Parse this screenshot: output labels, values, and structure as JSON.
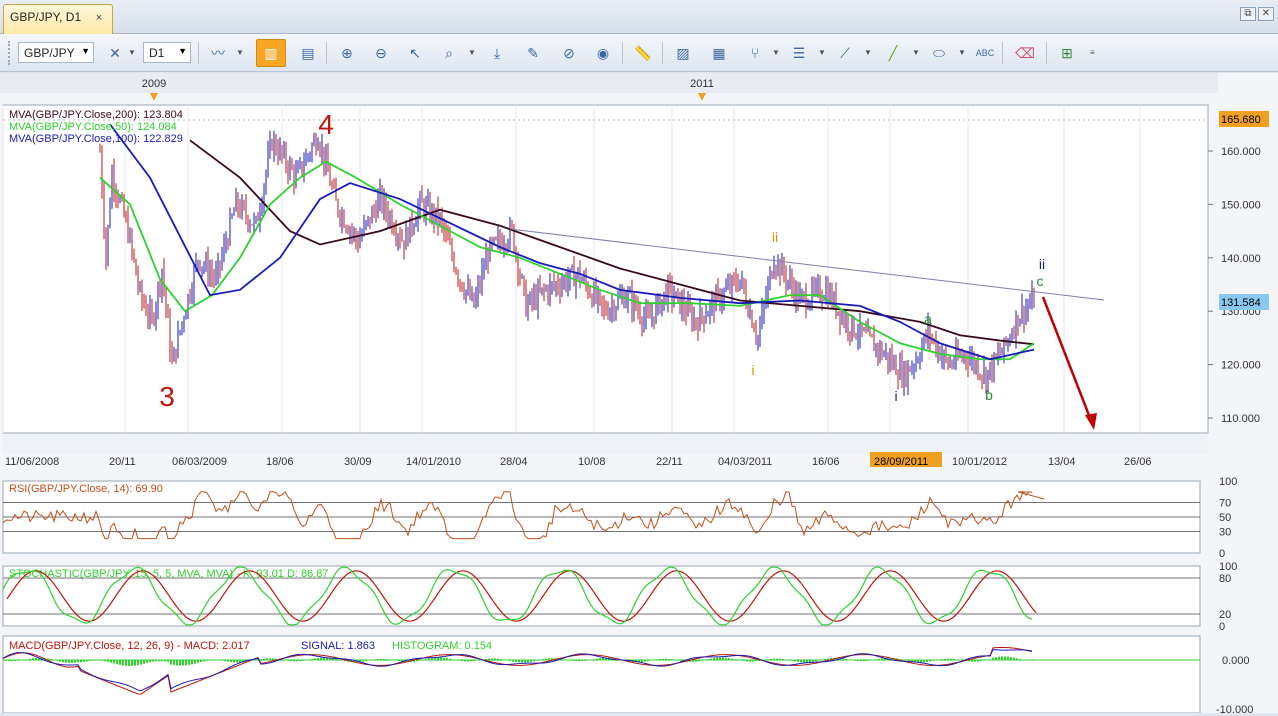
{
  "tab": {
    "title": "GBP/JPY, D1",
    "close": "×"
  },
  "window_buttons": [
    "⧉",
    "✕"
  ],
  "toolbar": {
    "symbol": "GBP/JPY",
    "timeframe": "D1",
    "tools": [
      "bar-chart-icon",
      "remove-indicator-icon",
      "line-chart-icon",
      "period-separator-icon",
      "template-icon",
      "zoom-in-icon",
      "zoom-out-icon",
      "cursor-icon",
      "indicator-icon",
      "auto-scroll-icon",
      "chart-shift-icon",
      "crosshair-icon",
      "globe-icon",
      "ruler-icon",
      "image-icon",
      "layout-icon",
      "fork-icon",
      "channel-icon",
      "fan-icon",
      "trendline-icon",
      "ellipse-icon",
      "text-label-icon",
      "eraser-icon",
      "object-list-icon"
    ]
  },
  "chart": {
    "year_labels": [
      "2009",
      "2011"
    ],
    "price_ticks": [
      "160.000",
      "150.000",
      "140.000",
      "130.000",
      "120.000",
      "110.000"
    ],
    "current_price": "131.584",
    "top_price": "165.680",
    "date_labels": [
      "11/06/2008",
      "20/11",
      "06/03/2009",
      "18/06",
      "30/09",
      "14/01/2010",
      "28/04",
      "10/08",
      "22/11",
      "04/03/2011",
      "16/06",
      "28/09/2011",
      "10/01/2012",
      "13/04",
      "26/06"
    ],
    "highlighted_date": "28/09/2011",
    "legend": [
      {
        "text": "MVA(GBP/JPY.Close,200): 123.804",
        "color": "#3b0a1a"
      },
      {
        "text": "MVA(GBP/JPY.Close,50): 124.084",
        "color": "#2ed22e"
      },
      {
        "text": "MVA(GBP/JPY.Close,100): 122.829",
        "color": "#1a1ab8"
      }
    ],
    "wave_labels": [
      {
        "text": "4",
        "color": "#c0140c"
      },
      {
        "text": "3",
        "color": "#c0140c"
      },
      {
        "text": "ii",
        "color": "#e08a00"
      },
      {
        "text": "i",
        "color": "#e08a00"
      },
      {
        "text": "i",
        "color": "#1a237e"
      },
      {
        "text": "ii",
        "color": "#1a237e"
      },
      {
        "text": "a",
        "color": "#2e8b2e"
      },
      {
        "text": "b",
        "color": "#2e8b2e"
      },
      {
        "text": "c",
        "color": "#2e8b2e"
      }
    ]
  },
  "rsi": {
    "label": "RSI(GBP/JPY.Close, 14): 69.90",
    "ticks": [
      "100",
      "70",
      "50",
      "30",
      "0"
    ]
  },
  "stoch": {
    "label": "STOCHASTIC(GBP/JPY, 15, 5, 5, MVA, MVA) - K: 93.01 D: 86.87",
    "ticks": [
      "100",
      "80",
      "20",
      "0"
    ]
  },
  "macd": {
    "label_prefix": "MACD(GBP/JPY.Close, 12, 26, 9) - MACD: 2.017",
    "signal": "SIGNAL: 1.863",
    "histogram": "HISTOGRAM: 0.154",
    "ticks": [
      "0.000",
      "-10.000"
    ]
  }
}
